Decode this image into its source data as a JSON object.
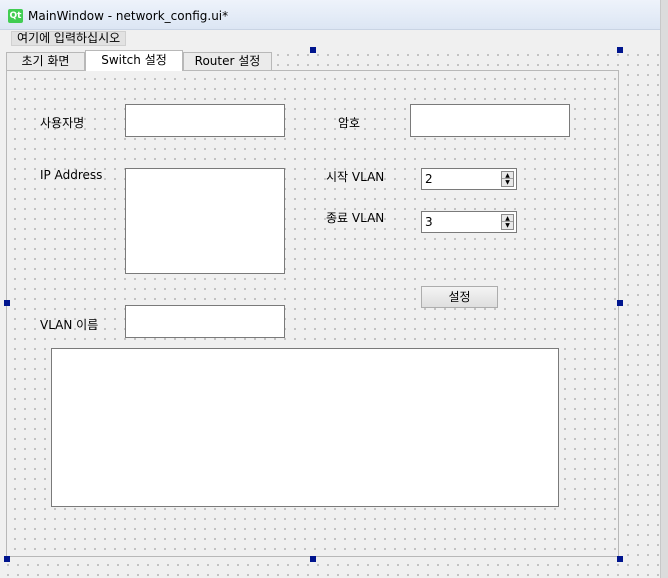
{
  "window": {
    "logo": "Qt",
    "title": "MainWindow - network_config.ui*"
  },
  "menu": {
    "placeholder": "여기에 입력하십시오"
  },
  "tabs": [
    {
      "label": "초기 화면",
      "active": false
    },
    {
      "label": "Switch 설정",
      "active": true
    },
    {
      "label": "Router 설정",
      "active": false
    }
  ],
  "form": {
    "username_label": "사용자명",
    "username_value": "",
    "password_label": "암호",
    "password_value": "",
    "ip_label": "IP Address",
    "ip_value": "",
    "start_vlan_label": "시작 VLAN",
    "start_vlan_value": "2",
    "end_vlan_label": "종료 VLAN",
    "end_vlan_value": "3",
    "vlan_name_label": "VLAN 이름",
    "vlan_name_value": "",
    "set_button": "설정",
    "output_text": ""
  },
  "colors": {
    "selection_handle": "#00158e",
    "qt_logo": "#41cd52"
  }
}
